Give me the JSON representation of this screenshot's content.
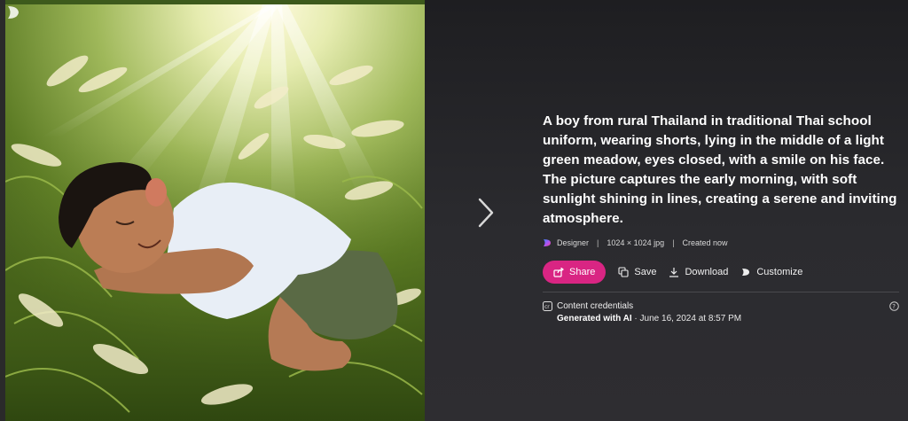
{
  "viewer": {
    "prompt": "A boy from rural Thailand in traditional Thai school uniform, wearing shorts, lying in the middle of a light green meadow, eyes closed, with a smile on his face. The picture captures the early morning, with soft sunlight shining in lines, creating a serene and inviting atmosphere.",
    "meta": {
      "app": "Designer",
      "size": "1024 × 1024 jpg",
      "created": "Created now"
    },
    "actions": {
      "share": "Share",
      "save": "Save",
      "download": "Download",
      "customize": "Customize"
    },
    "credentials": {
      "title": "Content credentials",
      "generated": "Generated with AI",
      "date": " · June 16, 2024 at 8:57 PM"
    },
    "icons": {
      "next": "chevron-right-icon",
      "designer": "designer-logo-icon",
      "share": "share-icon",
      "save": "save-icon",
      "download": "download-icon",
      "customize": "customize-icon",
      "credentials": "content-credentials-icon",
      "help": "help-icon"
    },
    "colors": {
      "accent": "#d92583",
      "background": "#2a2a2e"
    }
  }
}
